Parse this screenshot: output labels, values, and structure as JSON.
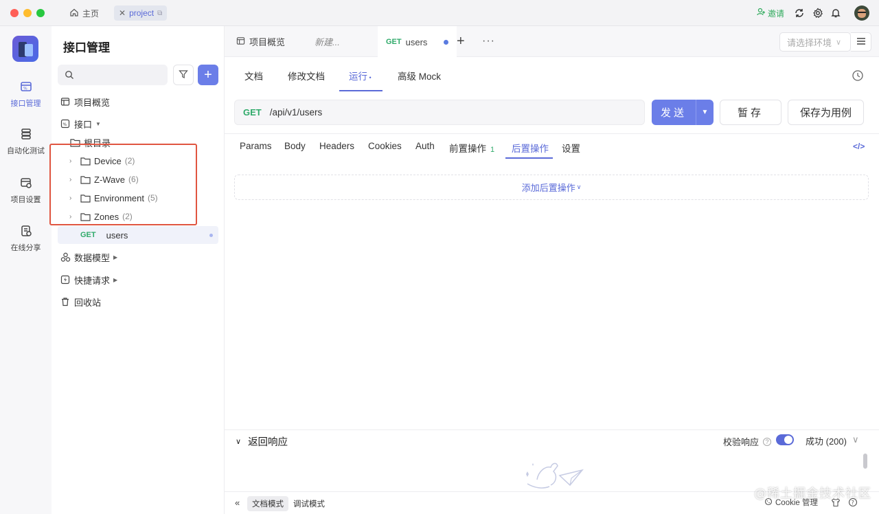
{
  "titlebar": {
    "home_tab": "主页",
    "project_tab": "project",
    "invite": "邀请"
  },
  "rail": {
    "items": [
      {
        "label": "接口管理",
        "icon": "api-icon"
      },
      {
        "label": "自动化测试",
        "icon": "automation-icon"
      },
      {
        "label": "项目设置",
        "icon": "project-settings-icon"
      },
      {
        "label": "在线分享",
        "icon": "share-icon"
      }
    ]
  },
  "sidebar": {
    "title": "接口管理",
    "overview": "项目概览",
    "interfaces": "接口",
    "root": "根目录",
    "folders": [
      {
        "name": "Device",
        "count": "(2)"
      },
      {
        "name": "Z-Wave",
        "count": "(6)"
      },
      {
        "name": "Environment",
        "count": "(5)"
      },
      {
        "name": "Zones",
        "count": "(2)"
      }
    ],
    "selected": {
      "method": "GET",
      "name": "users"
    },
    "data_models": "数据模型",
    "quick_requests": "快捷请求",
    "trash": "回收站"
  },
  "tabs": {
    "overview": "项目概览",
    "new": "新建...",
    "active_method": "GET",
    "active_name": "users",
    "env_placeholder": "请选择环境"
  },
  "subtabs": [
    "文档",
    "修改文档",
    "运行",
    "高级 Mock"
  ],
  "request": {
    "method": "GET",
    "url": "/api/v1/users",
    "send": "发送",
    "save_temp": "暂存",
    "save_case": "保存为用例"
  },
  "param_tabs": {
    "items": [
      "Params",
      "Body",
      "Headers",
      "Cookies",
      "Auth",
      "前置操作",
      "后置操作",
      "设置"
    ],
    "pre_badge": "1"
  },
  "post_ops": {
    "add": "添加后置操作"
  },
  "response": {
    "title": "返回响应",
    "verify": "校验响应",
    "status": "成功 (200)"
  },
  "footer": {
    "doc_mode": "文档模式",
    "debug_mode": "调试模式",
    "cookie": "Cookie 管理"
  },
  "watermark": "@稀土掘金技术社区",
  "colors": {
    "accent": "#5a6ad8",
    "primary_button": "#6b7ee8",
    "get_method": "#2faa6a",
    "annotation_box": "#e05540"
  }
}
